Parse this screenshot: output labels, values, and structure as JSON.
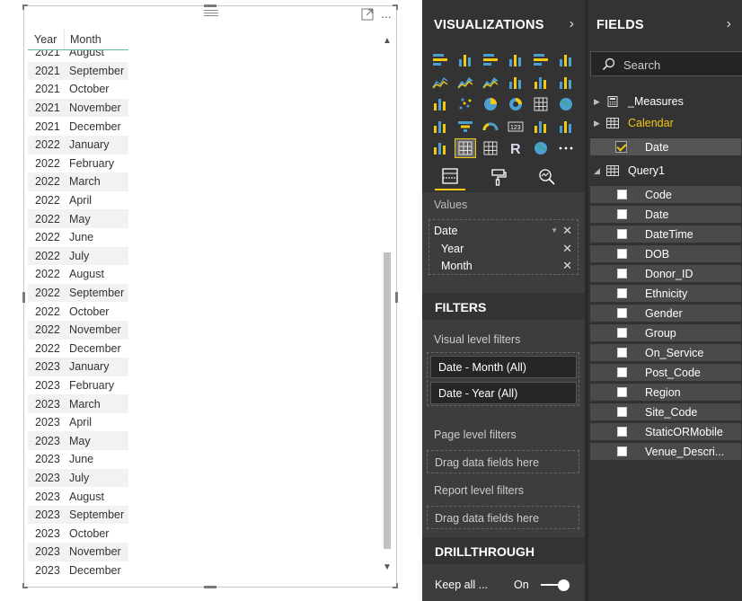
{
  "table": {
    "headers": [
      "Year",
      "Month"
    ],
    "rows": [
      [
        "2021",
        "August"
      ],
      [
        "2021",
        "September"
      ],
      [
        "2021",
        "October"
      ],
      [
        "2021",
        "November"
      ],
      [
        "2021",
        "December"
      ],
      [
        "2022",
        "January"
      ],
      [
        "2022",
        "February"
      ],
      [
        "2022",
        "March"
      ],
      [
        "2022",
        "April"
      ],
      [
        "2022",
        "May"
      ],
      [
        "2022",
        "June"
      ],
      [
        "2022",
        "July"
      ],
      [
        "2022",
        "August"
      ],
      [
        "2022",
        "September"
      ],
      [
        "2022",
        "October"
      ],
      [
        "2022",
        "November"
      ],
      [
        "2022",
        "December"
      ],
      [
        "2023",
        "January"
      ],
      [
        "2023",
        "February"
      ],
      [
        "2023",
        "March"
      ],
      [
        "2023",
        "April"
      ],
      [
        "2023",
        "May"
      ],
      [
        "2023",
        "June"
      ],
      [
        "2023",
        "July"
      ],
      [
        "2023",
        "August"
      ],
      [
        "2023",
        "September"
      ],
      [
        "2023",
        "October"
      ],
      [
        "2023",
        "November"
      ],
      [
        "2023",
        "December"
      ]
    ]
  },
  "visual": {
    "more_label": "···"
  },
  "visualizations": {
    "title": "VISUALIZATIONS",
    "chevron": "›",
    "icons": [
      "stacked-bar-icon",
      "stacked-column-icon",
      "clustered-bar-icon",
      "clustered-column-icon",
      "100-stacked-bar-icon",
      "100-stacked-column-icon",
      "line-chart-icon",
      "area-chart-icon",
      "stacked-area-icon",
      "line-column-icon",
      "line-clustered-column-icon",
      "ribbon-chart-icon",
      "waterfall-icon",
      "scatter-icon",
      "pie-icon",
      "donut-icon",
      "treemap-icon",
      "map-icon",
      "filled-map-icon",
      "funnel-icon",
      "gauge-icon",
      "card-icon",
      "multirow-card-icon",
      "kpi-icon",
      "slicer-icon",
      "table-icon",
      "matrix-icon",
      "r-visual-icon",
      "globe-icon",
      "more-icon"
    ],
    "selected_icon": "table-icon",
    "values_label": "Values",
    "value_items": [
      {
        "label": "Date",
        "kind": "hierarchy"
      },
      {
        "label": "Year",
        "kind": "field"
      },
      {
        "label": "Month",
        "kind": "field"
      }
    ],
    "filters_title": "FILTERS",
    "visual_filters_label": "Visual level filters",
    "visual_filters": [
      "Date - Month  (All)",
      "Date - Year  (All)"
    ],
    "page_filters_label": "Page level filters",
    "report_filters_label": "Report level filters",
    "drag_placeholder": "Drag data fields here",
    "drillthrough_title": "DRILLTHROUGH",
    "keep_all_label": "Keep all ...",
    "keep_all_state": "On"
  },
  "fields": {
    "title": "FIELDS",
    "chevron": "›",
    "search_placeholder": "Search",
    "tables": [
      {
        "name": "_Measures",
        "expanded": false,
        "highlight": false
      },
      {
        "name": "Calendar",
        "expanded": false,
        "highlight": true
      },
      {
        "name": "Query1",
        "expanded": true,
        "highlight": false
      }
    ],
    "calendar_fields": [
      {
        "name": "Date",
        "checked": true
      }
    ],
    "query1_fields": [
      {
        "name": "Code",
        "checked": false
      },
      {
        "name": "Date",
        "checked": false
      },
      {
        "name": "DateTime",
        "checked": false
      },
      {
        "name": "DOB",
        "checked": false
      },
      {
        "name": "Donor_ID",
        "checked": false
      },
      {
        "name": "Ethnicity",
        "checked": false
      },
      {
        "name": "Gender",
        "checked": false
      },
      {
        "name": "Group",
        "checked": false
      },
      {
        "name": "On_Service",
        "checked": false
      },
      {
        "name": "Post_Code",
        "checked": false
      },
      {
        "name": "Region",
        "checked": false
      },
      {
        "name": "Site_Code",
        "checked": false
      },
      {
        "name": "StaticORMobile",
        "checked": false
      },
      {
        "name": "Venue_Descri...",
        "checked": false
      }
    ]
  },
  "colors": {
    "accent": "#f2c811",
    "pane_bg": "#333333",
    "header_rule": "#5fb9a7"
  }
}
